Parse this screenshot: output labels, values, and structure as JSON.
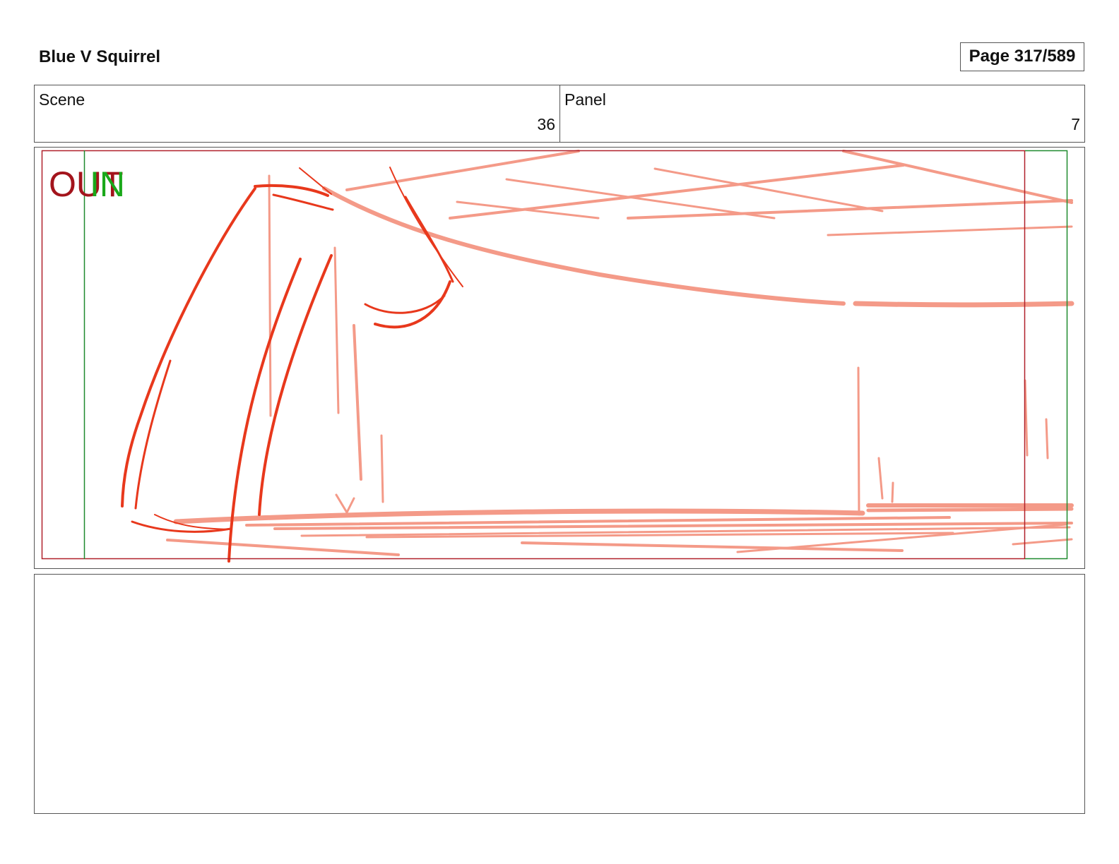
{
  "header": {
    "title": "Blue V Squirrel",
    "page_label": "Page 317/589"
  },
  "info": {
    "scene_label": "Scene",
    "scene_value": "36",
    "panel_label": "Panel",
    "panel_value": "7"
  },
  "panel": {
    "out_marker": "OUT",
    "in_marker": "IN",
    "colors": {
      "sketch_dark": "#e8381c",
      "sketch_light": "#f49a88",
      "out_frame": "#b0202a",
      "in_frame": "#1f8a2e",
      "out_text": "#a3141c",
      "in_text": "#1aa81a"
    }
  },
  "notes": {
    "text": ""
  }
}
